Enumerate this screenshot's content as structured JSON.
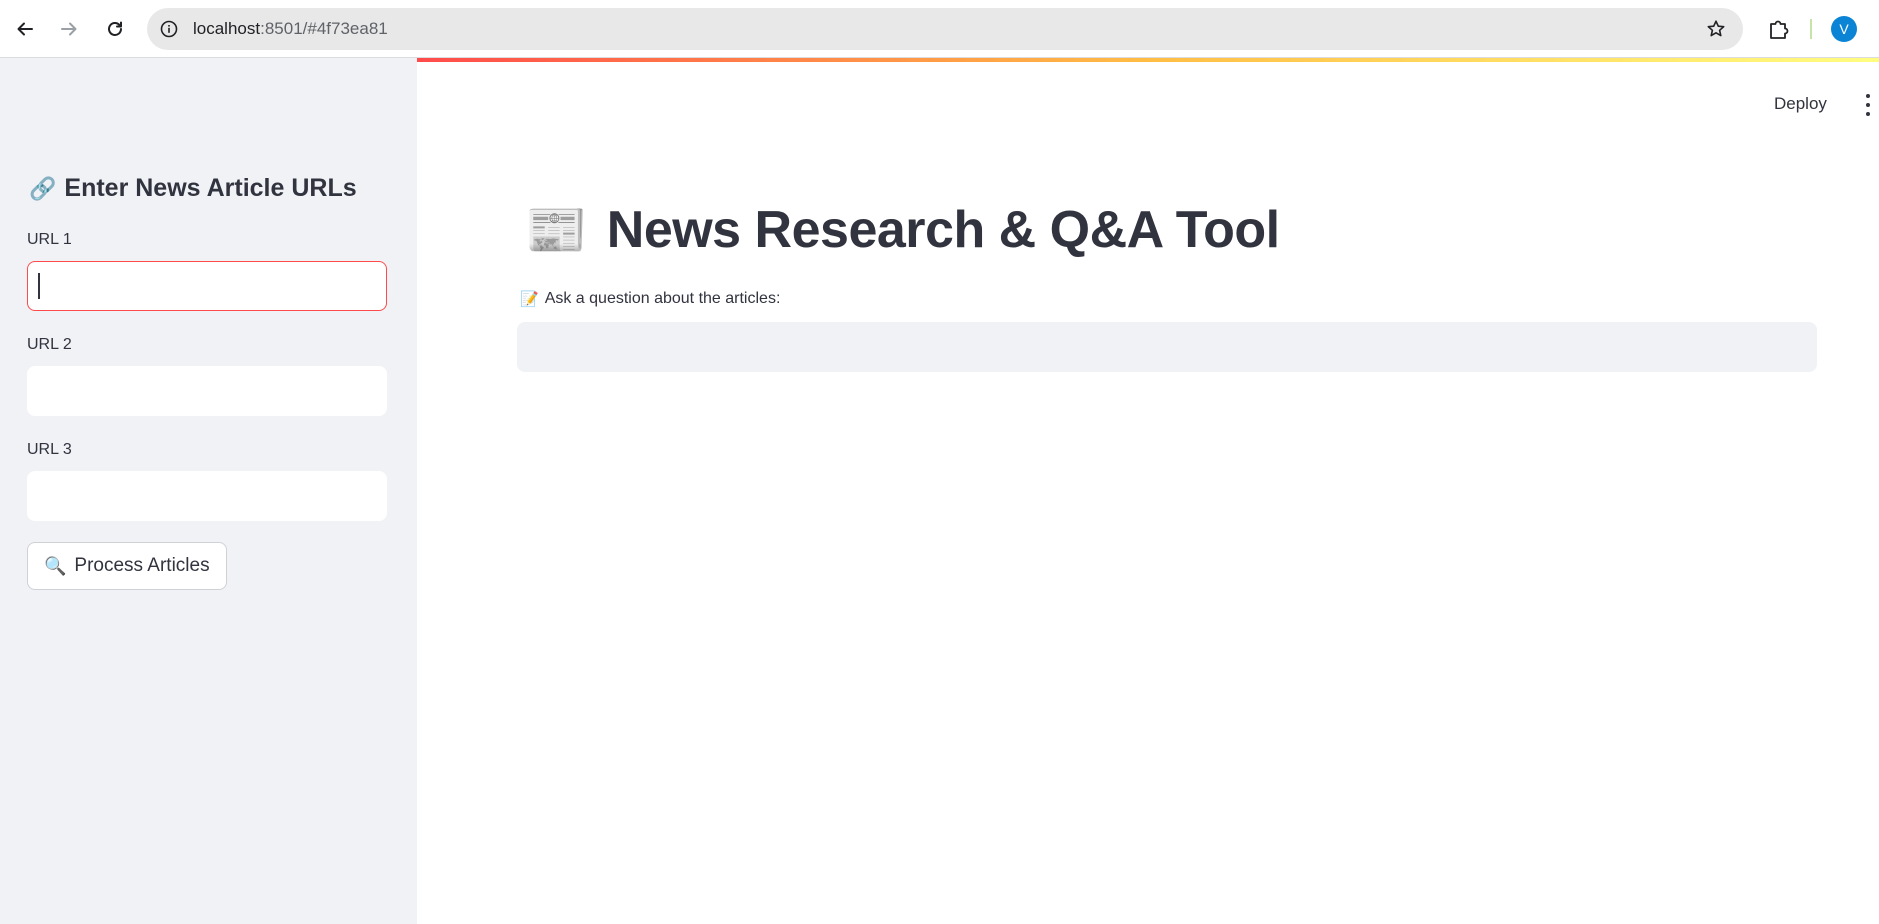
{
  "browser": {
    "url_host": "localhost",
    "url_rest": ":8501/#4f73ea81",
    "profile_initial": "V"
  },
  "sidebar": {
    "title_icon": "🔗",
    "title": "Enter News Article URLs",
    "fields": [
      {
        "label": "URL 1",
        "value": "",
        "focused": true
      },
      {
        "label": "URL 2",
        "value": ""
      },
      {
        "label": "URL 3",
        "value": ""
      }
    ],
    "process_button": {
      "icon": "🔍",
      "label": "Process Articles"
    }
  },
  "header": {
    "deploy_label": "Deploy"
  },
  "main": {
    "title_icon": "📰",
    "title": "News Research & Q&A Tool",
    "question_icon": "📝",
    "question_label": "Ask a question about the articles:",
    "question_value": ""
  },
  "colors": {
    "accent": "#ff4b4b",
    "sidebar_bg": "#f0f2f6",
    "text": "#31333f",
    "profile": "#0b84d6"
  },
  "icons": {
    "back": "arrow-left-icon",
    "forward": "arrow-right-icon",
    "reload": "reload-icon",
    "info": "info-icon",
    "bookmark": "star-icon",
    "extensions": "puzzle-icon",
    "menu": "kebab-menu-icon"
  }
}
